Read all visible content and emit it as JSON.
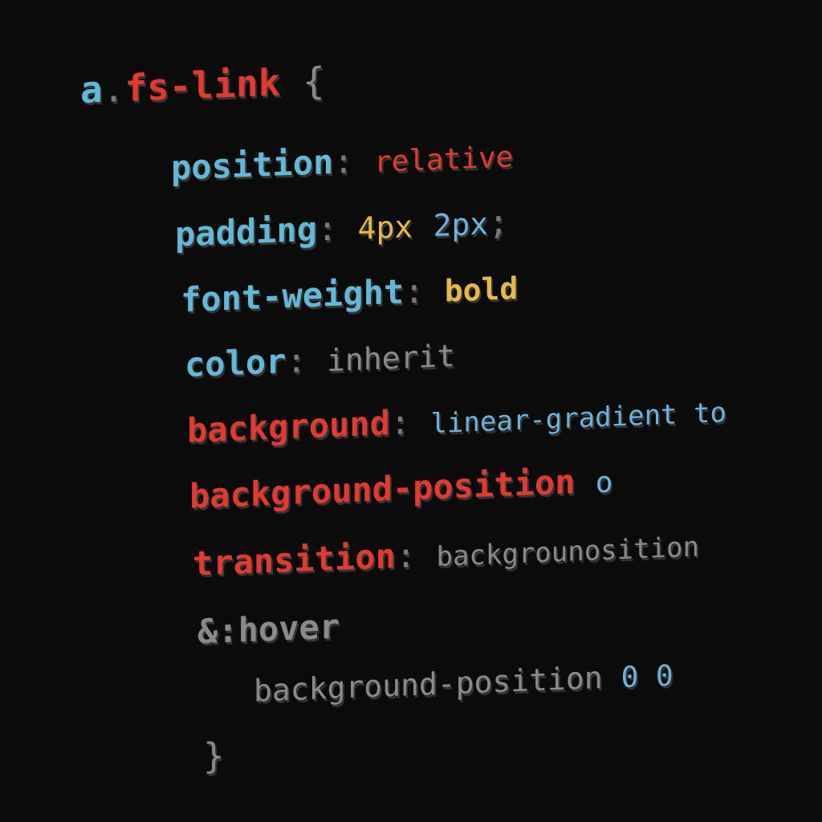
{
  "code": {
    "line1": {
      "selector_tag": "a",
      "dot": ".",
      "class_name": "fs-link",
      "open_brace": "{"
    },
    "line2": {
      "property": "position",
      "colon": ":",
      "value": "relative"
    },
    "line3": {
      "property": "padding",
      "colon": ":",
      "value_a": "4px",
      "value_b": "2px",
      "semicolon": ";"
    },
    "line4": {
      "property": "font-weight",
      "colon": ":",
      "value": "bold"
    },
    "line5": {
      "property": "color",
      "colon": ":",
      "value": "inherit"
    },
    "line6": {
      "property": "background",
      "colon": ":",
      "value": "linear-gradient to"
    },
    "line7": {
      "property": "background-position",
      "value": "o"
    },
    "line8": {
      "property": "transition",
      "colon": ":",
      "value": "backgrounosition"
    },
    "line9": {
      "selector": "&:hover"
    },
    "line10": {
      "property": "background-position",
      "value": "0 0"
    },
    "line11": {
      "close_brace": "}"
    }
  },
  "colors": {
    "background": "#0b0b0b",
    "selector": "#62b8d7",
    "keyword_red": "#e23a2f",
    "value_blue": "#6ab3dc",
    "value_gold": "#e5b84a",
    "muted_grey": "#8a8a8a"
  }
}
